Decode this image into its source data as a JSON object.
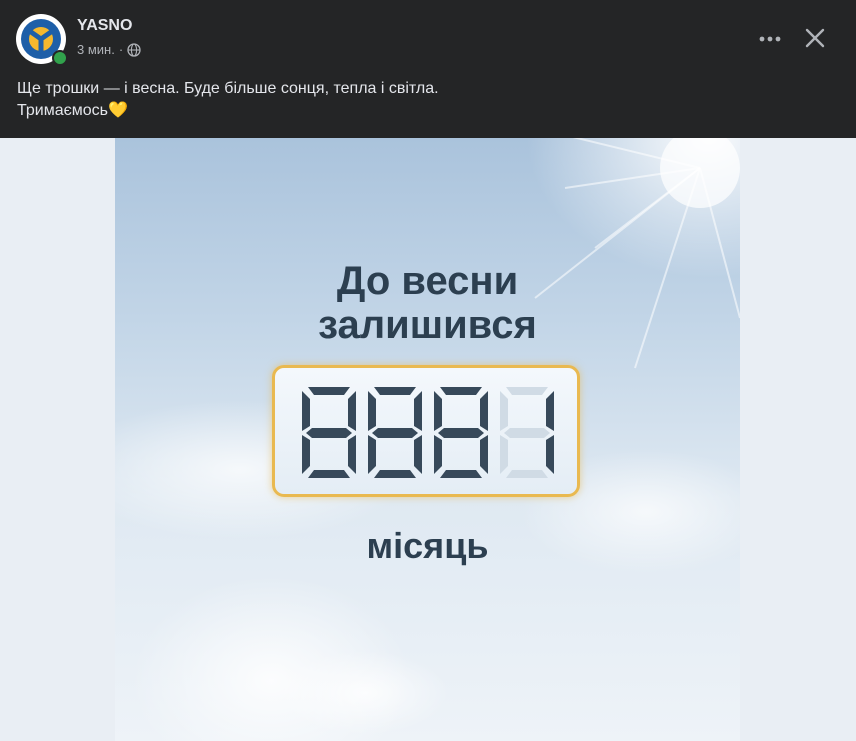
{
  "post": {
    "author": "YASNO",
    "time": "3 мин.",
    "separator": "·",
    "text_line1": "Ще трошки — і весна. Буде більше сонця, тепла і світла.",
    "text_line2": "Тримаємось",
    "emoji": "💛"
  },
  "image": {
    "headline_line1": "До весни",
    "headline_line2": "залишився",
    "counter_digit": "1",
    "unit_label": "місяць"
  },
  "icons": {
    "more": "more-options-icon",
    "close": "close-icon",
    "audience": "globe-icon",
    "logo": "yasno-logo-icon"
  },
  "colors": {
    "background": "#242526",
    "text": "#e4e6eb",
    "secondary_text": "#b0b3b8",
    "accent_gold": "#e9b950",
    "headline": "#2c3f50",
    "online": "#31a24c"
  }
}
